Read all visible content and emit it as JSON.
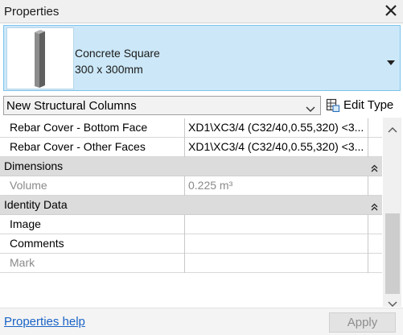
{
  "palette": {
    "title": "Properties",
    "close_icon": "close-icon"
  },
  "type_selector": {
    "line1": "Concrete Square",
    "line2": "300 x 300mm",
    "thumbnail_icon": "column-preview-icon",
    "selected_bg": "#cce8f8"
  },
  "filter": {
    "value": "New Structural Columns",
    "chevron_icon": "chevron-down-icon"
  },
  "edit_type": {
    "label": "Edit Type",
    "icon": "edit-type-icon"
  },
  "rows": [
    {
      "name": "Rebar Cover - Bottom Face",
      "value": "XD1\\XC3/4 (C32/40,0.55,320) <3..."
    },
    {
      "name": "Rebar Cover - Other Faces",
      "value": "XD1\\XC3/4 (C32/40,0.55,320) <3..."
    }
  ],
  "groups": {
    "dimensions": {
      "label": "Dimensions",
      "collapse_icon": "collapse-icon"
    },
    "volume": {
      "name": "Volume",
      "value": "0.225 m³"
    },
    "identity": {
      "label": "Identity Data",
      "collapse_icon": "collapse-icon"
    },
    "identity_rows": [
      {
        "name": "Image",
        "value": ""
      },
      {
        "name": "Comments",
        "value": ""
      },
      {
        "name": "Mark",
        "value": ""
      }
    ]
  },
  "footer": {
    "help_link": "Properties help",
    "apply_label": "Apply"
  }
}
